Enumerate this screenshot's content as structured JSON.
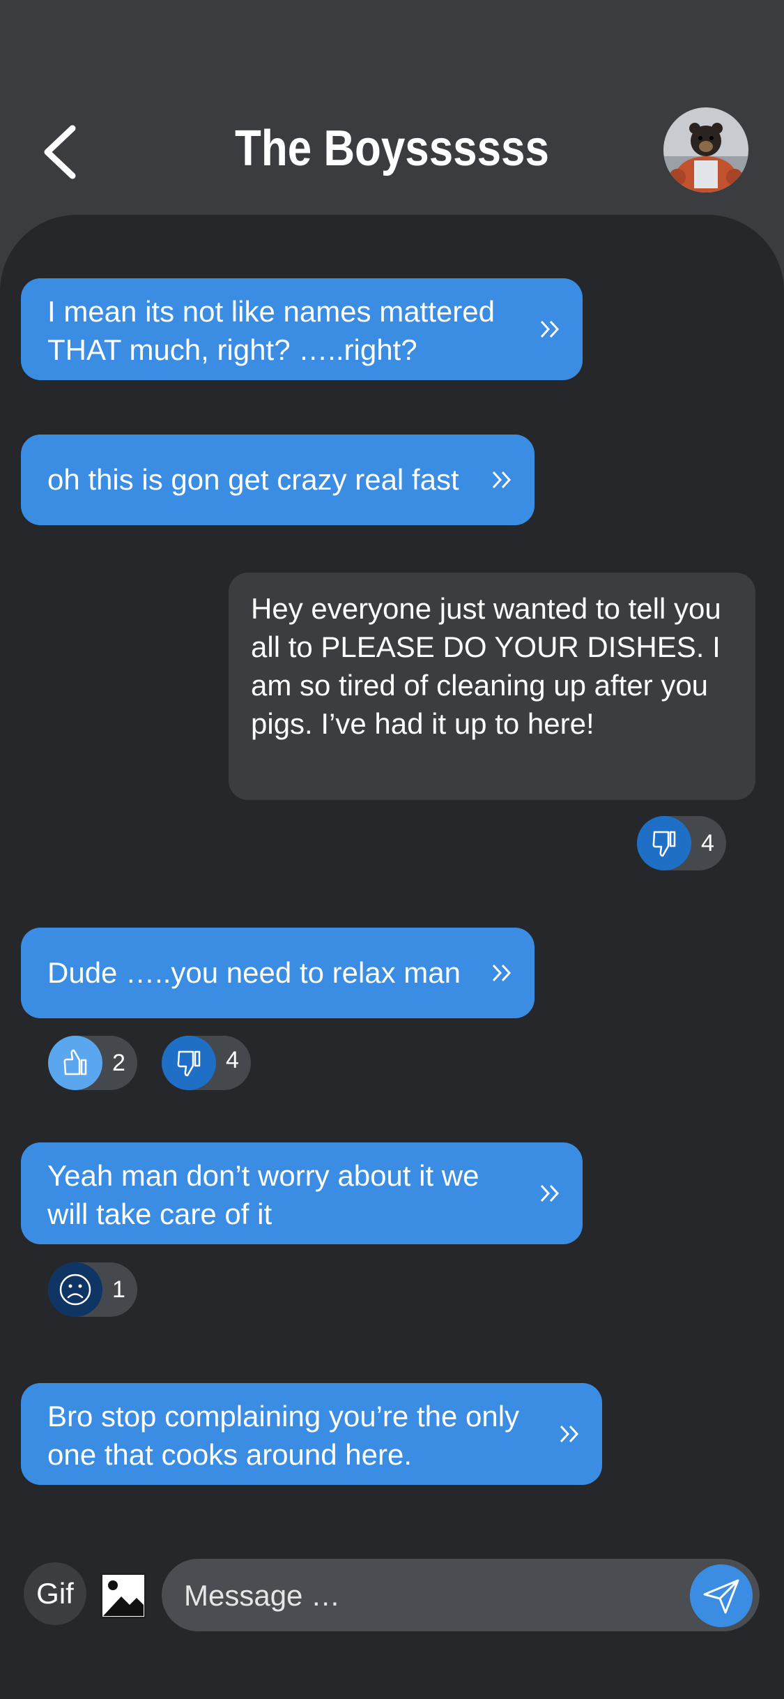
{
  "header": {
    "title": "The Boyssssss",
    "back_icon": "chevron-left-icon",
    "avatar": "group-avatar"
  },
  "messages": [
    {
      "text": "I mean its not like names mattered THAT much, right? …..right?",
      "side": "left"
    },
    {
      "text": "oh this is gon get crazy real fast",
      "side": "left"
    },
    {
      "text": "Hey everyone just wanted to tell you all to PLEASE DO YOUR DISHES. I am so tired of cleaning up after you pigs. I’ve had it up to here!",
      "side": "right",
      "reactions": [
        {
          "icon": "thumbs-down-icon",
          "count": "4"
        }
      ]
    },
    {
      "text": "Dude …..you need to relax man",
      "side": "left",
      "reactions": [
        {
          "icon": "thumbs-up-icon",
          "count": "2"
        },
        {
          "icon": "thumbs-down-icon",
          "count": "4"
        }
      ]
    },
    {
      "text": "Yeah man don’t worry about it we will take care of it",
      "side": "left",
      "reactions": [
        {
          "icon": "sad-face-icon",
          "count": "1"
        }
      ]
    },
    {
      "text": "Bro stop complaining you’re the only one that cooks around here.",
      "side": "left"
    }
  ],
  "composer": {
    "gif_label": "Gif",
    "placeholder": "Message …",
    "image_icon": "image-icon",
    "send_icon": "send-icon"
  },
  "colors": {
    "accent": "#3a8de3",
    "background": "#25272a",
    "header": "#3a3c3f"
  }
}
